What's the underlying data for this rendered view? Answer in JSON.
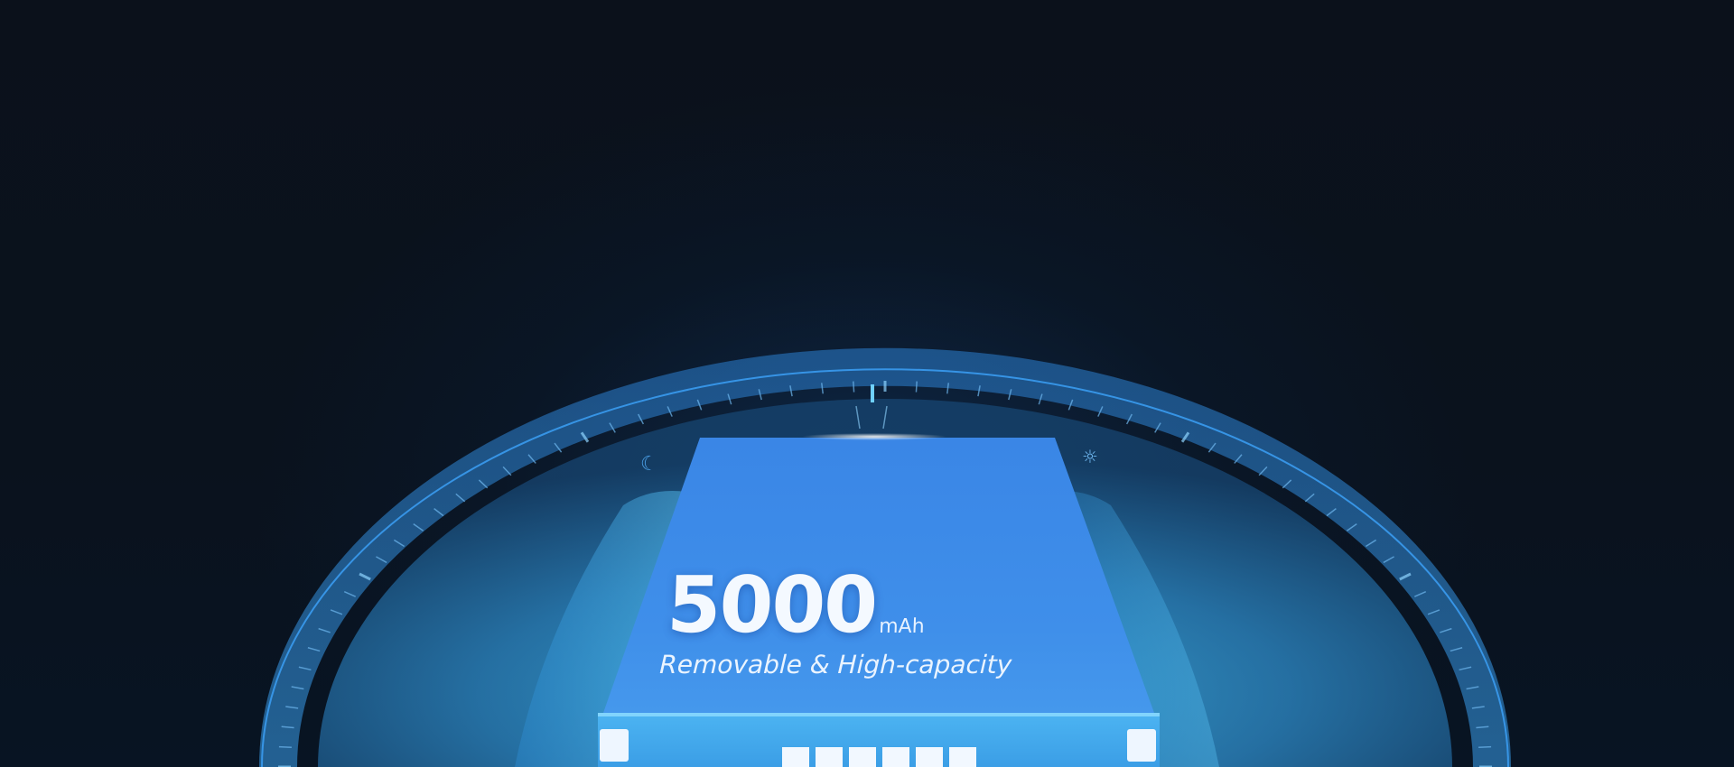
{
  "hero": {
    "capacity_value": "5000",
    "capacity_unit": "mAh",
    "tagline": "Removable & High-capacity"
  },
  "icons": {
    "night": "moon-icon",
    "day": "sun-icon"
  },
  "colors": {
    "background": "#0a1018",
    "dial_ring": "#2f8fe0",
    "battery_top": "#3f8fe8",
    "battery_front": "#4aa8ee",
    "glow": "#5fc4f0"
  }
}
